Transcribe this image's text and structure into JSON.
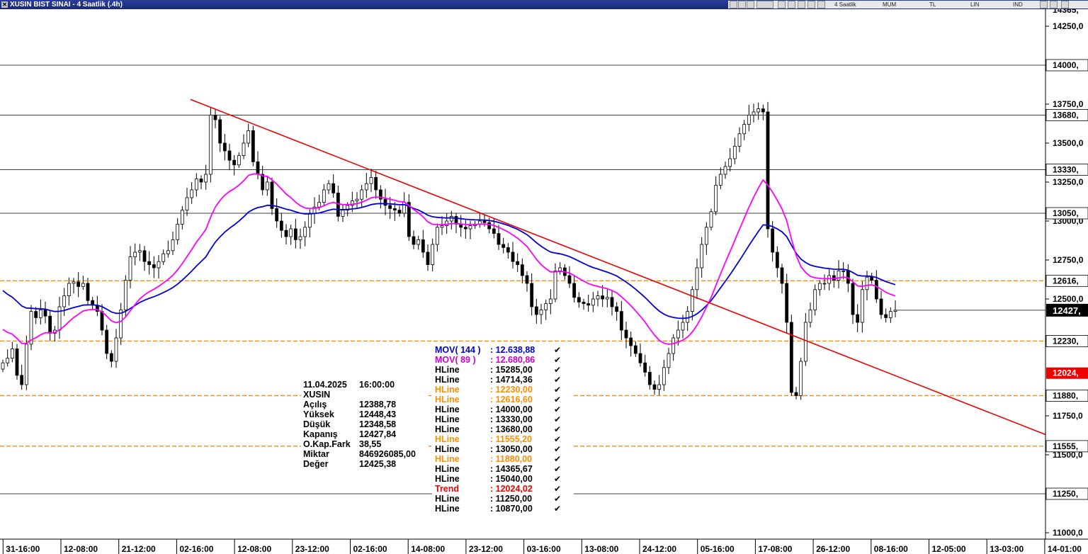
{
  "window": {
    "title": "XUSIN BIST SINAI - 4 Saatlik (.4h)",
    "toolbar": {
      "period": "4 Saatlik",
      "mode1": "MUM",
      "mode2": "TL",
      "mode3": "LIN",
      "mode4": "IND"
    }
  },
  "chart_data": {
    "type": "candlestick",
    "y_range": [
      10930,
      14420
    ],
    "x_labels": [
      "31-16:00",
      "12-08:00",
      "21-12:00",
      "02-16:00",
      "12-08:00",
      "23-12:00",
      "02-16:00",
      "14-08:00",
      "23-12:00",
      "03-16:00",
      "13-08:00",
      "24-12:00",
      "05-16:00",
      "17-08:00",
      "26-12:00",
      "08-16:00",
      "12-05:00",
      "13-03:00",
      "14-01:00"
    ],
    "y_ticks": [
      "14250,0",
      "13750,0",
      "13500,0",
      "13250,0",
      "13000,0",
      "12750,0",
      "12500,0",
      "11750,0",
      "11500,0",
      "11000,0"
    ],
    "y_ticks_values": [
      14250,
      13750,
      13500,
      13250,
      13000,
      12750,
      12500,
      11750,
      11500,
      11000
    ],
    "top_partial_label": "14365,",
    "hlines": [
      {
        "value": 14000.0,
        "label": "14000,",
        "style": "solid"
      },
      {
        "value": 13680.0,
        "label": "13680,",
        "style": "solid"
      },
      {
        "value": 13330.0,
        "label": "13330,",
        "style": "solid"
      },
      {
        "value": 13050.0,
        "label": "13050,",
        "style": "solid"
      },
      {
        "value": 12616.6,
        "label": "12616,",
        "style": "dashed"
      },
      {
        "value": 12230.0,
        "label": "12230,",
        "style": "dashed"
      },
      {
        "value": 11880.0,
        "label": "11880,",
        "style": "dashed"
      },
      {
        "value": 11555.2,
        "label": "11555,",
        "style": "dashed"
      },
      {
        "value": 11250.0,
        "label": "11250,",
        "style": "solid"
      }
    ],
    "last_price": {
      "value": 12427.84,
      "label": "12427,"
    },
    "trend": {
      "label": "12024,",
      "value": 12024.02,
      "start": [
        269,
        13780
      ],
      "end": [
        1476,
        11630
      ]
    },
    "closes": [
      12090,
      12120,
      12180,
      12010,
      11950,
      12210,
      12420,
      12380,
      12430,
      12390,
      12280,
      12300,
      12450,
      12520,
      12600,
      12610,
      12580,
      12600,
      12490,
      12460,
      12420,
      12300,
      12150,
      12100,
      12250,
      12430,
      12620,
      12770,
      12800,
      12810,
      12740,
      12720,
      12700,
      12740,
      12790,
      12810,
      12880,
      12980,
      13070,
      13150,
      13200,
      13270,
      13250,
      13300,
      13680,
      13650,
      13500,
      13450,
      13390,
      13360,
      13420,
      13500,
      13580,
      13380,
      13300,
      13200,
      13250,
      13080,
      13000,
      12940,
      12900,
      12950,
      12880,
      12900,
      12960,
      13050,
      13090,
      13120,
      13200,
      13240,
      13180,
      13030,
      13070,
      13100,
      13130,
      13140,
      13200,
      13240,
      13280,
      13200,
      13140,
      13100,
      13080,
      13070,
      13050,
      13120,
      12900,
      12850,
      12880,
      12800,
      12720,
      12850,
      12960,
      12970,
      13000,
      13030,
      12980,
      12960,
      12950,
      12970,
      12980,
      13000,
      12990,
      12950,
      12920,
      12850,
      12830,
      12800,
      12740,
      12720,
      12650,
      12600,
      12450,
      12400,
      12430,
      12470,
      12500,
      12680,
      12700,
      12650,
      12600,
      12510,
      12480,
      12470,
      12460,
      12500,
      12520,
      12500,
      12510,
      12450,
      12420,
      12300,
      12250,
      12200,
      12150,
      12090,
      12030,
      11950,
      11920,
      11950,
      12060,
      12150,
      12250,
      12300,
      12350,
      12420,
      12560,
      12700,
      12850,
      12960,
      13060,
      13230,
      13300,
      13350,
      13400,
      13480,
      13560,
      13620,
      13680,
      13700,
      13720,
      13700,
      12950,
      12800,
      12700,
      12600,
      12350,
      11900,
      11880,
      12100,
      12350,
      12430,
      12560,
      12600,
      12600,
      12650,
      12620,
      12680,
      12680,
      12600,
      12400,
      12350,
      12560,
      12640,
      12620,
      12500,
      12400,
      12380,
      12420,
      12427.84
    ]
  },
  "data_window": {
    "date": "11.04.2025",
    "time": "16:00:00",
    "symbol": "XUSIN",
    "rows": [
      {
        "label": "Açılış",
        "value": "12388,78"
      },
      {
        "label": "Yüksek",
        "value": "12448,43"
      },
      {
        "label": "Düşük",
        "value": "12348,58"
      },
      {
        "label": "Kapanış",
        "value": "12427,84"
      },
      {
        "label": "O.Kap.Fark",
        "value": "38,55"
      },
      {
        "label": "Miktar",
        "value": "846926085,00"
      },
      {
        "label": "Değer",
        "value": "12425,38"
      }
    ]
  },
  "indicator_legend": [
    {
      "name": "MOV( 144 )",
      "value": ": 12.638,88",
      "color": "#0000cc",
      "bold": true
    },
    {
      "name": "MOV( 89 )",
      "value": ": 12.680,86",
      "color": "#cc00cc",
      "bold": true
    },
    {
      "name": "HLine",
      "value": ": 15285,00",
      "color": "#000000"
    },
    {
      "name": "HLine",
      "value": ": 14714,36",
      "color": "#000000"
    },
    {
      "name": "HLine",
      "value": ": 12230,00",
      "color": "#ff8c00"
    },
    {
      "name": "HLine",
      "value": ": 12616,60",
      "color": "#ff8c00"
    },
    {
      "name": "HLine",
      "value": ": 14000,00",
      "color": "#000000"
    },
    {
      "name": "HLine",
      "value": ": 13330,00",
      "color": "#000000"
    },
    {
      "name": "HLine",
      "value": ": 13680,00",
      "color": "#000000"
    },
    {
      "name": "HLine",
      "value": ": 11555,20",
      "color": "#ff8c00"
    },
    {
      "name": "HLine",
      "value": ": 13050,00",
      "color": "#000000"
    },
    {
      "name": "HLine",
      "value": ": 11880,00",
      "color": "#ff8c00"
    },
    {
      "name": "HLine",
      "value": ": 14365,67",
      "color": "#000000"
    },
    {
      "name": "HLine",
      "value": ": 15040,00",
      "color": "#000000"
    },
    {
      "name": "Trend",
      "value": ": 12024,02",
      "color": "#ee0000"
    },
    {
      "name": "HLine",
      "value": ": 11250,00",
      "color": "#000000"
    },
    {
      "name": "HLine",
      "value": ": 10870,00",
      "color": "#000000"
    }
  ],
  "colors": {
    "ma144": "#0000dd",
    "ma89": "#ff00ff",
    "trend": "#ee0000",
    "hline_dashed": "#ff8c00",
    "hline_solid": "#000000",
    "last_price_bg": "#000000",
    "trend_bg": "#ee0000"
  }
}
